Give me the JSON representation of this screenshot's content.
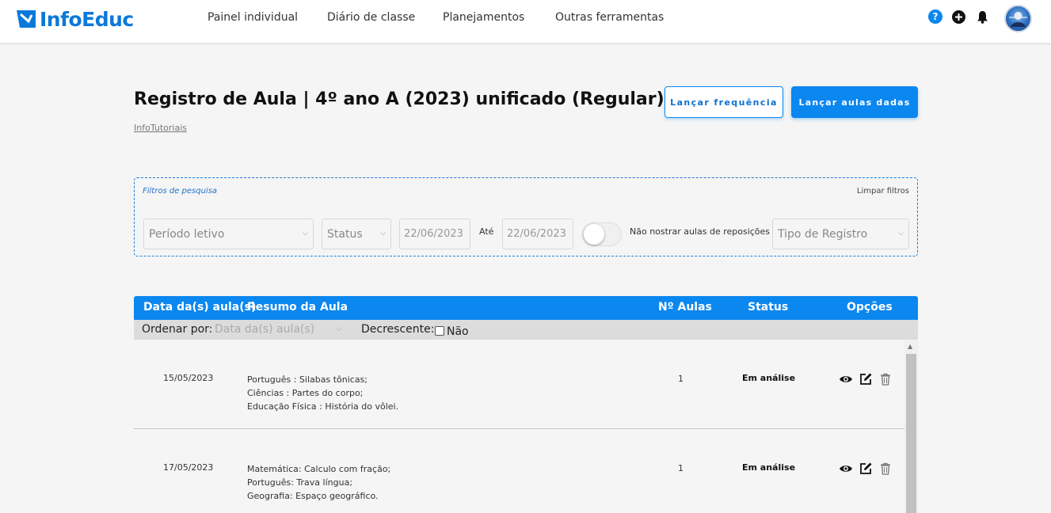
{
  "brand": {
    "name": "InfoEduc",
    "color": "#0b79d9"
  },
  "nav": {
    "items": [
      {
        "label": "Painel individual"
      },
      {
        "label": "Diário de classe"
      },
      {
        "label": "Planejamentos"
      },
      {
        "label": "Outras ferramentas"
      }
    ],
    "help_glyph": "?",
    "icons": [
      "help-icon",
      "add-circle-icon",
      "bell-icon",
      "avatar"
    ]
  },
  "header": {
    "title": "Registro de Aula | 4º ano A (2023) unificado (Regular)",
    "sublink": "InfoTutoriais",
    "btn_frequency": "Lançar frequência",
    "btn_classes": "Lançar aulas dadas"
  },
  "filters": {
    "title": "Filtros de pesquisa",
    "clear": "Limpar filtros",
    "period": "Período letivo",
    "status": "Status",
    "date_from": "22/06/2023",
    "until": "Até",
    "date_to": "22/06/2023",
    "toggle_label": "Não nostrar aulas de reposições",
    "toggle_on": false,
    "record_type": "Tipo de Registro"
  },
  "table": {
    "headers": {
      "date": "Data da(s) aula(s)",
      "summary": "Resumo da Aula",
      "count": "Nº Aulas",
      "status": "Status",
      "options": "Opções"
    },
    "sort": {
      "label": "Ordenar por:",
      "field": "Data da(s) aula(s)",
      "desc_label": "Decrescente:",
      "desc_value": "Não",
      "desc_checked": false
    },
    "rows": [
      {
        "date": "15/05/2023",
        "summary": [
          "Português : Silabas tônicas;",
          "Ciências : Partes do corpo;",
          "Educação Física : História do vôlei."
        ],
        "count": "1",
        "status": "Em análise"
      },
      {
        "date": "17/05/2023",
        "summary": [
          "Matemática: Calculo com fração;",
          "Português: Trava língua;",
          "Geografia: Espaço geográfico."
        ],
        "count": "1",
        "status": "Em análise"
      }
    ]
  },
  "colors": {
    "primary": "#0b87f0",
    "accent_dark": "#0b6fd0"
  }
}
